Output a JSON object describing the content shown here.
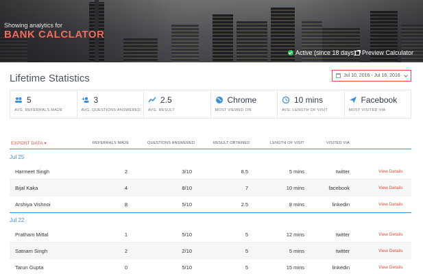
{
  "header": {
    "subtitle": "Showing analytics for",
    "title": "BANK CALCLATOR",
    "status": "Active (since 18 days)",
    "preview": "Preview Calculator"
  },
  "page": {
    "title": "Lifetime Statistics",
    "date_range": "Jul 10, 2016 - Jul 16, 2016"
  },
  "stats": [
    {
      "value": "5",
      "label": "AVG. REFERRALS MADE",
      "icon": "users-icon"
    },
    {
      "value": "3",
      "label": "AVG. QUESTIONS ANSWERED",
      "icon": "add-user-icon"
    },
    {
      "value": "2.5",
      "label": "AVG. RESULT",
      "icon": "trend-icon"
    },
    {
      "value": "Chrome",
      "label": "MOST VIEWED ON",
      "icon": "globe-icon"
    },
    {
      "value": "10 mins",
      "label": "AVG. LENGTH OF VISIT",
      "icon": "clock-icon"
    },
    {
      "value": "Facebook",
      "label": "MOST VISITED VIA",
      "icon": "send-icon"
    }
  ],
  "table": {
    "export_label": "EXPORT DATA",
    "headers": [
      "REFERRALS MADE",
      "QUESTIONS ANSWERED",
      "RESULT OBTAINED",
      "LENGTH OF VISIT",
      "VISITED VIA"
    ],
    "groups": [
      {
        "date": "Jul 25",
        "rows": [
          {
            "name": "Harmeet Singh",
            "referrals": "2",
            "questions": "3/10",
            "result": "8.5",
            "length": "5 mins",
            "via": "twitter",
            "action": "View Details"
          },
          {
            "name": "Bijal Kaka",
            "referrals": "4",
            "questions": "8/10",
            "result": "7",
            "length": "10 mins",
            "via": "facebook",
            "action": "View Details"
          },
          {
            "name": "Arshiya Vishnoi",
            "referrals": "8",
            "questions": "5/10",
            "result": "2.5",
            "length": "8 mins",
            "via": "linkedin",
            "action": "View Details"
          }
        ]
      },
      {
        "date": "Jul 22",
        "rows": [
          {
            "name": "Pratham Mittal",
            "referrals": "1",
            "questions": "5/10",
            "result": "5",
            "length": "12 mins",
            "via": "twitter",
            "action": "View Details"
          },
          {
            "name": "Satnam Singh",
            "referrals": "2",
            "questions": "2/10",
            "result": "5",
            "length": "5 mins",
            "via": "twitter",
            "action": "View Details"
          },
          {
            "name": "Tarun Gupta",
            "referrals": "0",
            "questions": "5/10",
            "result": "5",
            "length": "15 mins",
            "via": "linkedin",
            "action": "View Details"
          }
        ]
      }
    ]
  },
  "colors": {
    "accent": "#e84b3a",
    "link_blue": "#3a8fd8",
    "active_green": "#2bc25b"
  }
}
